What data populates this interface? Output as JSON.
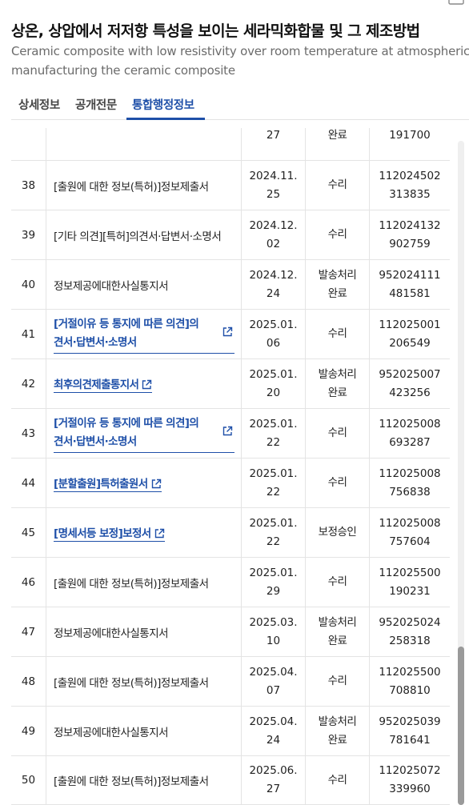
{
  "page": {
    "title": "상온, 상압에서 저저항 특성을 보이는 세라믹화합물 및 그 제조방법",
    "subtitle_line1": "Ceramic composite with low resistivity over room temperature at atmospheric",
    "subtitle_line2": "manufacturing the ceramic composite"
  },
  "tabs": [
    {
      "label": "상세정보"
    },
    {
      "label": "공개전문"
    },
    {
      "label": "통합행정정보"
    }
  ],
  "active_tab": "통합행정정보",
  "accent_color": "#1e4fa8",
  "rows": [
    {
      "no": "",
      "name": "",
      "date1": "27",
      "date2": "",
      "status1": "완료",
      "status2": "",
      "rno1": "191700",
      "rno2": "",
      "link": false
    },
    {
      "no": "38",
      "name": "[출원에 대한 정보(특허)]정보제출서",
      "date1": "2024.11.",
      "date2": "25",
      "status1": "수리",
      "status2": "",
      "rno1": "112024502",
      "rno2": "313835",
      "link": false
    },
    {
      "no": "39",
      "name": "[기타 의견][특허]의견서·답변서·소명서",
      "date1": "2024.12.",
      "date2": "02",
      "status1": "수리",
      "status2": "",
      "rno1": "112024132",
      "rno2": "902759",
      "link": false
    },
    {
      "no": "40",
      "name": "정보제공에대한사실통지서",
      "date1": "2024.12.",
      "date2": "24",
      "status1": "발송처리",
      "status2": "완료",
      "rno1": "952024111",
      "rno2": "481581",
      "link": false
    },
    {
      "no": "41",
      "name1": "[거절이유 등 통지에 따른 의견]의",
      "name2": "견서·답변서·소명서",
      "date1": "2025.01.",
      "date2": "06",
      "status1": "수리",
      "status2": "",
      "rno1": "112025001",
      "rno2": "206549",
      "link": true
    },
    {
      "no": "42",
      "name": "최후의견제출통지서",
      "date1": "2025.01.",
      "date2": "20",
      "status1": "발송처리",
      "status2": "완료",
      "rno1": "952025007",
      "rno2": "423256",
      "link": true
    },
    {
      "no": "43",
      "name1": "[거절이유 등 통지에 따른 의견]의",
      "name2": "견서·답변서·소명서",
      "date1": "2025.01.",
      "date2": "22",
      "status1": "수리",
      "status2": "",
      "rno1": "112025008",
      "rno2": "693287",
      "link": true
    },
    {
      "no": "44",
      "name": "[분할출원]특허출원서",
      "date1": "2025.01.",
      "date2": "22",
      "status1": "수리",
      "status2": "",
      "rno1": "112025008",
      "rno2": "756838",
      "link": true
    },
    {
      "no": "45",
      "name": "[명세서등 보정]보정서",
      "date1": "2025.01.",
      "date2": "22",
      "status1": "보정승인",
      "status2": "",
      "rno1": "112025008",
      "rno2": "757604",
      "link": true
    },
    {
      "no": "46",
      "name": "[출원에 대한 정보(특허)]정보제출서",
      "date1": "2025.01.",
      "date2": "29",
      "status1": "수리",
      "status2": "",
      "rno1": "112025500",
      "rno2": "190231",
      "link": false
    },
    {
      "no": "47",
      "name": "정보제공에대한사실통지서",
      "date1": "2025.03.",
      "date2": "10",
      "status1": "발송처리",
      "status2": "완료",
      "rno1": "952025024",
      "rno2": "258318",
      "link": false
    },
    {
      "no": "48",
      "name": "[출원에 대한 정보(특허)]정보제출서",
      "date1": "2025.04.",
      "date2": "07",
      "status1": "수리",
      "status2": "",
      "rno1": "112025500",
      "rno2": "708810",
      "link": false
    },
    {
      "no": "49",
      "name": "정보제공에대한사실통지서",
      "date1": "2025.04.",
      "date2": "24",
      "status1": "발송처리",
      "status2": "완료",
      "rno1": "952025039",
      "rno2": "781641",
      "link": false
    },
    {
      "no": "50",
      "name": "[출원에 대한 정보(특허)]정보제출서",
      "date1": "2025.06.",
      "date2": "27",
      "status1": "수리",
      "status2": "",
      "rno1": "112025072",
      "rno2": "339960",
      "link": false
    }
  ]
}
